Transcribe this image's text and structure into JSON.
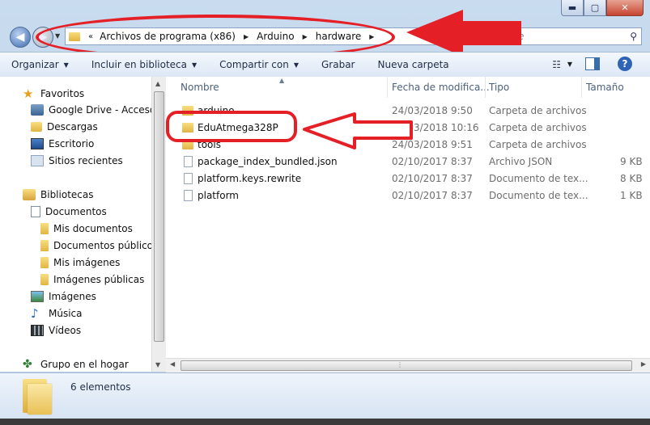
{
  "window": {
    "buttons": {
      "minimize": "▬",
      "maximize": "▢",
      "close": "✕"
    }
  },
  "address_bar": {
    "overflow": "«",
    "crumbs": [
      "Archivos de programa (x86)",
      "Arduino",
      "hardware"
    ]
  },
  "search": {
    "placeholder": "e"
  },
  "toolbar": {
    "organize": "Organizar",
    "include_library": "Incluir en biblioteca",
    "share_with": "Compartir con",
    "burn": "Grabar",
    "new_folder": "Nueva carpeta"
  },
  "sidebar": {
    "favorites_label": "Favoritos",
    "favorites": [
      "Google Drive - Acceso d",
      "Descargas",
      "Escritorio",
      "Sitios recientes"
    ],
    "libraries_label": "Bibliotecas",
    "documents_label": "Documentos",
    "documents_children": [
      "Mis documentos",
      "Documentos públicos"
    ],
    "images_children": [
      "Mis imágenes",
      "Imágenes públicas"
    ],
    "libraries_rest": [
      "Imágenes",
      "Música",
      "Vídeos"
    ],
    "homegroup": "Grupo en el hogar"
  },
  "columns": {
    "name": "Nombre",
    "date": "Fecha de modifica...",
    "type": "Tipo",
    "size": "Tamaño"
  },
  "files": [
    {
      "name": "arduino",
      "date": "24/03/2018 9:50",
      "type": "Carpeta de archivos",
      "size": "",
      "kind": "folder"
    },
    {
      "name": "EduAtmega328P",
      "date": "24/03/2018 10:16",
      "type": "Carpeta de archivos",
      "size": "",
      "kind": "folder"
    },
    {
      "name": "tools",
      "date": "24/03/2018 9:51",
      "type": "Carpeta de archivos",
      "size": "",
      "kind": "folder"
    },
    {
      "name": "package_index_bundled.json",
      "date": "02/10/2017 8:37",
      "type": "Archivo JSON",
      "size": "9 KB",
      "kind": "file"
    },
    {
      "name": "platform.keys.rewrite",
      "date": "02/10/2017 8:37",
      "type": "Documento de tex...",
      "size": "8 KB",
      "kind": "file"
    },
    {
      "name": "platform",
      "date": "02/10/2017 8:37",
      "type": "Documento de tex...",
      "size": "1 KB",
      "kind": "file"
    }
  ],
  "details": {
    "item_count": "6 elementos"
  },
  "colors": {
    "annotation_red": "#e51f26",
    "accent_blue": "#2f63b5"
  }
}
